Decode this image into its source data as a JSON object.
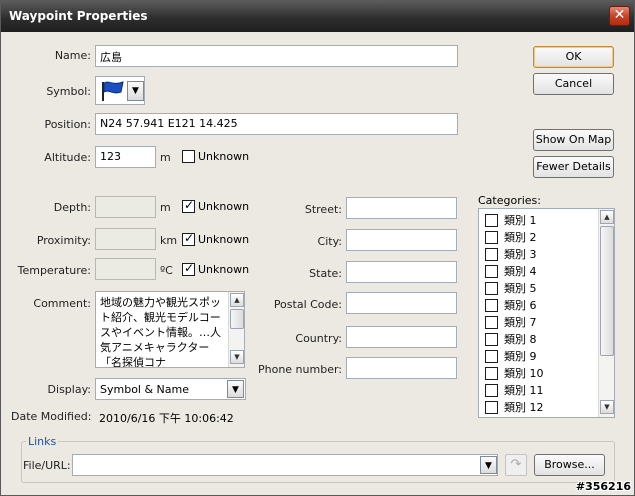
{
  "window": {
    "title": "Waypoint Properties",
    "close_icon": "close-icon"
  },
  "labels": {
    "name": "Name:",
    "symbol": "Symbol:",
    "position": "Position:",
    "altitude": "Altitude:",
    "depth": "Depth:",
    "proximity": "Proximity:",
    "temperature": "Temperature:",
    "comment": "Comment:",
    "display": "Display:",
    "date_modified": "Date Modified:",
    "street": "Street:",
    "city": "City:",
    "state": "State:",
    "postal_code": "Postal Code:",
    "country": "Country:",
    "phone": "Phone number:",
    "categories": "Categories:",
    "links": "Links",
    "file_url": "File/URL:"
  },
  "fields": {
    "name": "広島",
    "position": "N24 57.941 E121 14.425",
    "altitude": "123",
    "altitude_unit": "m",
    "depth": "",
    "depth_unit": "m",
    "proximity": "",
    "proximity_unit": "km",
    "temperature": "",
    "temperature_unit": "ºC",
    "street": "",
    "city": "",
    "state": "",
    "postal_code": "",
    "country": "",
    "phone": "",
    "file_url": "",
    "display": "Symbol & Name",
    "date_modified": "2010/6/16 下午 10:06:42",
    "comment": "地域の魅力や観光スポット紹介、観光モデルコースやイベント情報。…人気アニメキャラクター「名探偵コナ"
  },
  "checkboxes": {
    "altitude_unknown": {
      "label": "Unknown",
      "checked": false
    },
    "depth_unknown": {
      "label": "Unknown",
      "checked": true
    },
    "proximity_unknown": {
      "label": "Unknown",
      "checked": true
    },
    "temperature_unknown": {
      "label": "Unknown",
      "checked": true
    }
  },
  "buttons": {
    "ok": "OK",
    "cancel": "Cancel",
    "show_on_map": "Show On Map",
    "fewer_details": "Fewer Details",
    "browse": "Browse..."
  },
  "categories": [
    {
      "label": "類別 1",
      "checked": false
    },
    {
      "label": "類別 2",
      "checked": false
    },
    {
      "label": "類別 3",
      "checked": false
    },
    {
      "label": "類別 4",
      "checked": false
    },
    {
      "label": "類別 5",
      "checked": false
    },
    {
      "label": "類別 6",
      "checked": false
    },
    {
      "label": "類別 7",
      "checked": false
    },
    {
      "label": "類別 8",
      "checked": false
    },
    {
      "label": "類別 9",
      "checked": false
    },
    {
      "label": "類別 10",
      "checked": false
    },
    {
      "label": "類別 11",
      "checked": false
    },
    {
      "label": "類別 12",
      "checked": false
    }
  ],
  "symbol_icon": "blue-flag-icon",
  "watermark": "#356216",
  "colors": {
    "titlebar": "#2e2e2e",
    "close": "#c64328",
    "flag": "#1a4fc4",
    "links_title": "#1d4fa8"
  }
}
